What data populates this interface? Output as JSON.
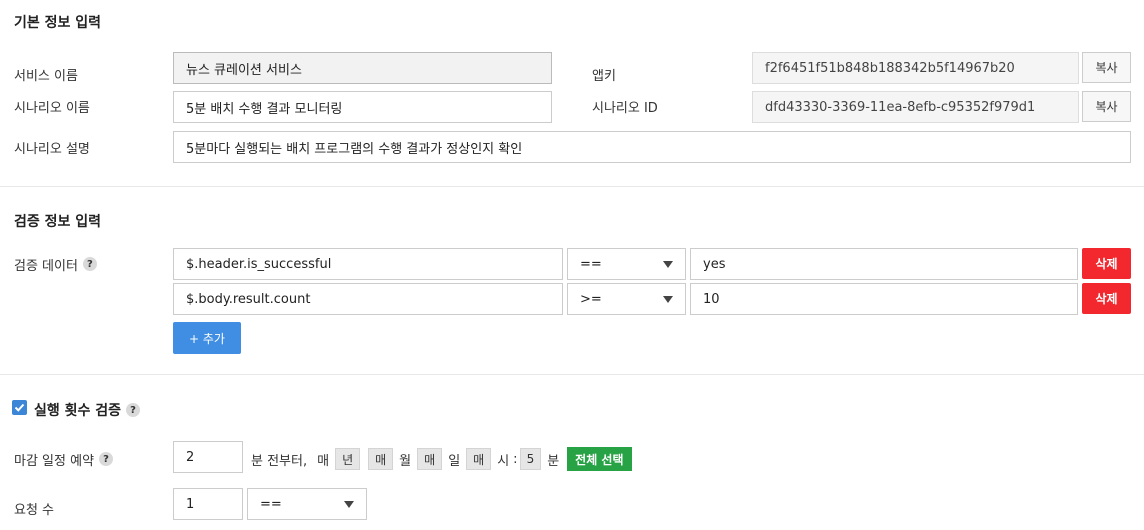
{
  "basic": {
    "title": "기본 정보 입력",
    "service_name_label": "서비스 이름",
    "service_name_value": "뉴스 큐레이션 서비스",
    "scenario_name_label": "시나리오 이름",
    "scenario_name_value": "5분 배치 수행 결과 모니터링",
    "scenario_desc_label": "시나리오 설명",
    "scenario_desc_value": "5분마다 실행되는 배치 프로그램의 수행 결과가 정상인지 확인",
    "appkey_label": "앱키",
    "appkey_value": "f2f6451f51b848b188342b5f14967b20",
    "scenario_id_label": "시나리오 ID",
    "scenario_id_value": "dfd43330-3369-11ea-8efb-c95352f979d1",
    "copy_label": "복사"
  },
  "verify": {
    "title": "검증 정보 입력",
    "data_label": "검증 데이터",
    "help_glyph": "?",
    "rows": [
      {
        "path": "$.header.is_successful",
        "op": "==",
        "value": "yes"
      },
      {
        "path": "$.body.result.count",
        "op": ">=",
        "value": "10"
      }
    ],
    "delete_label": "삭제",
    "add_label": "+ 추가"
  },
  "exec": {
    "checkbox_checked": true,
    "title": "실행 횟수 검증",
    "deadline_label": "마감 일정 예약",
    "deadline_value": "2",
    "before_text": "분 전부터,",
    "every": "매",
    "year_chip": "년",
    "month_chip": "매",
    "month_text": "월",
    "day_chip": "매",
    "day_text": "일",
    "hour_chip": "매",
    "hour_text": "시",
    "colon": ":",
    "minute_chip": "5",
    "minute_text": "분",
    "select_all_label": "전체 선택",
    "request_count_label": "요청 수",
    "request_count_value": "1",
    "request_op": "=="
  },
  "colors": {
    "primary": "#3f8ee3",
    "danger": "#f3282e",
    "success": "#27a244",
    "checkbox": "#3b86d6"
  }
}
